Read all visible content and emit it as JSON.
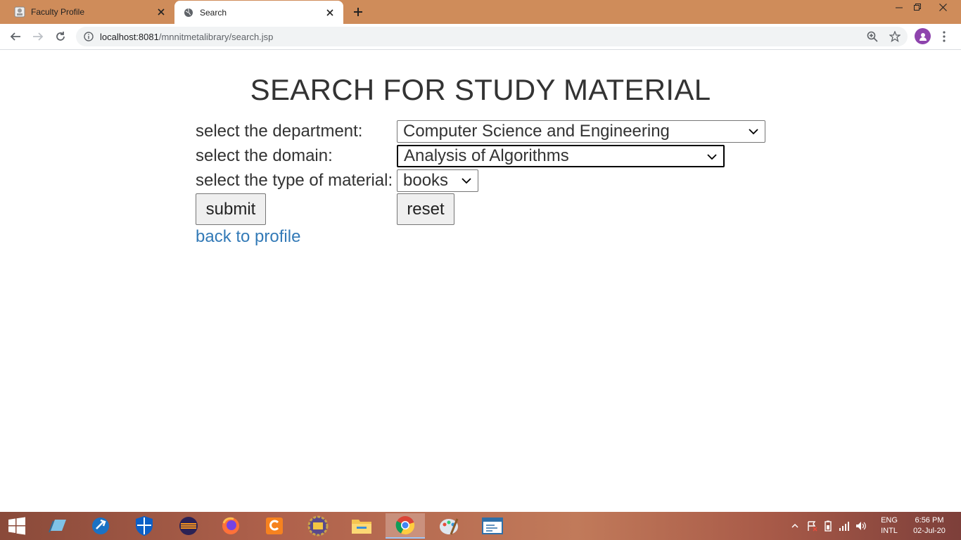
{
  "browser": {
    "tabs": [
      {
        "title": "Faculty Profile",
        "active": false
      },
      {
        "title": "Search",
        "active": true
      }
    ],
    "address": {
      "host": "localhost:8081",
      "path": "/mnnitmetalibrary/search.jsp"
    }
  },
  "page": {
    "heading": "SEARCH FOR STUDY MATERIAL",
    "department": {
      "label": "select the department:",
      "selected": "Computer Science and Engineering"
    },
    "domain": {
      "label": "select the domain:",
      "selected": "Analysis of Algorithms"
    },
    "material": {
      "label": "select the type of material:",
      "selected": "books"
    },
    "submit_label": "submit",
    "reset_label": "reset",
    "back_link": "back to profile"
  },
  "taskbar": {
    "apps": [
      "file-manager",
      "edge-like",
      "defender",
      "eclipse",
      "firefox",
      "pdf-reader",
      "java-ee-ide",
      "file-explorer",
      "chrome",
      "paint",
      "notepad-window"
    ],
    "active_app": "chrome",
    "language": {
      "line1": "ENG",
      "line2": "INTL"
    },
    "clock": {
      "time": "6:56 PM",
      "date": "02-Jul-20"
    }
  },
  "colors": {
    "titlebar": "#cf8c5a",
    "link": "#337ab7",
    "heading": "#333333"
  }
}
